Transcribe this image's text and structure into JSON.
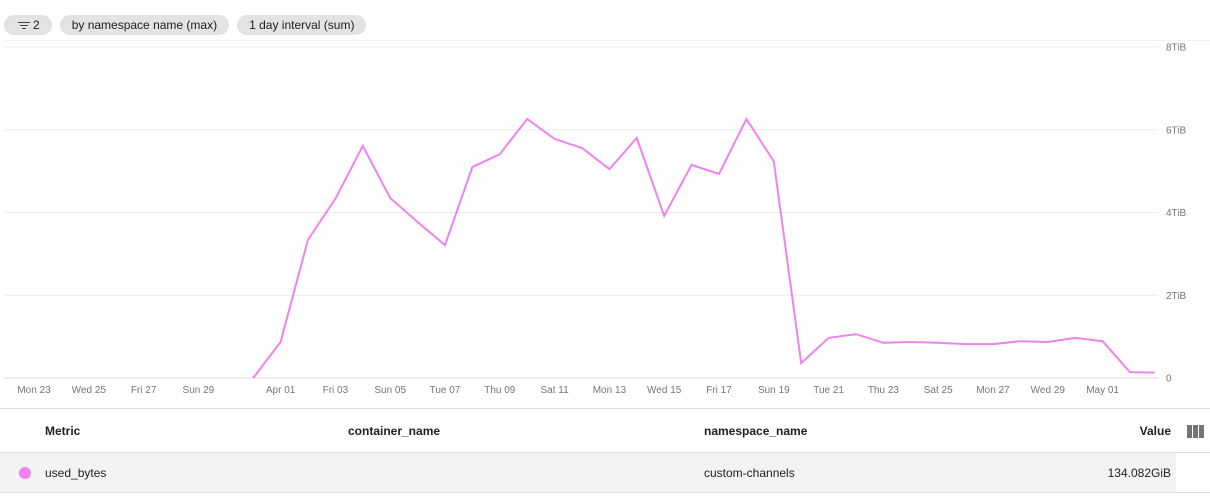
{
  "toolbar": {
    "filter_count": "2",
    "chips": [
      "by namespace name (max)",
      "1 day interval (sum)"
    ]
  },
  "chart_data": {
    "type": "line",
    "title": "",
    "xlabel": "",
    "ylabel": "",
    "y_unit": "TiB",
    "ylim": [
      0,
      8
    ],
    "yticks": [
      {
        "value": 0,
        "label": "0"
      },
      {
        "value": 2,
        "label": "2TiB"
      },
      {
        "value": 4,
        "label": "4TiB"
      },
      {
        "value": 6,
        "label": "6TiB"
      },
      {
        "value": 8,
        "label": "8TiB"
      }
    ],
    "x_range_days": [
      -1.5,
      40.6
    ],
    "xticks": [
      {
        "day": 0,
        "label": "Mon 23"
      },
      {
        "day": 2,
        "label": "Wed 25"
      },
      {
        "day": 4,
        "label": "Fri 27"
      },
      {
        "day": 6,
        "label": "Sun 29"
      },
      {
        "day": 9,
        "label": "Apr 01"
      },
      {
        "day": 11,
        "label": "Fri 03"
      },
      {
        "day": 13,
        "label": "Sun 05"
      },
      {
        "day": 15,
        "label": "Tue 07"
      },
      {
        "day": 17,
        "label": "Thu 09"
      },
      {
        "day": 19,
        "label": "Sat 11"
      },
      {
        "day": 21,
        "label": "Mon 13"
      },
      {
        "day": 23,
        "label": "Wed 15"
      },
      {
        "day": 25,
        "label": "Fri 17"
      },
      {
        "day": 27,
        "label": "Sun 19"
      },
      {
        "day": 29,
        "label": "Tue 21"
      },
      {
        "day": 31,
        "label": "Thu 23"
      },
      {
        "day": 33,
        "label": "Sat 25"
      },
      {
        "day": 35,
        "label": "Mon 27"
      },
      {
        "day": 37,
        "label": "Wed 29"
      },
      {
        "day": 39,
        "label": "May 01"
      }
    ],
    "grid": true,
    "legend": "table-below",
    "series": [
      {
        "name": "used_bytes",
        "color": "#ee82ee",
        "x_days": [
          8,
          9,
          10,
          11,
          12,
          13,
          14,
          15,
          16,
          17,
          18,
          19,
          20,
          21,
          22,
          23,
          24,
          25,
          26,
          27,
          28,
          29,
          30,
          31,
          32,
          33,
          34,
          35,
          36,
          37,
          38,
          39,
          40,
          40.9
        ],
        "values": [
          0,
          0.87,
          3.34,
          4.33,
          5.61,
          4.35,
          3.77,
          3.21,
          5.1,
          5.41,
          6.26,
          5.78,
          5.56,
          5.05,
          5.8,
          3.92,
          5.15,
          4.93,
          6.26,
          5.24,
          0.36,
          0.97,
          1.06,
          0.85,
          0.87,
          0.85,
          0.82,
          0.82,
          0.89,
          0.87,
          0.97,
          0.89,
          0.14,
          0.13
        ]
      }
    ]
  },
  "table": {
    "headers": {
      "metric": "Metric",
      "container_name": "container_name",
      "namespace_name": "namespace_name",
      "value": "Value"
    },
    "rows": [
      {
        "metric": "used_bytes",
        "color": "#ee82ee",
        "container_name": "",
        "namespace_name": "custom-channels",
        "value": "134.082GiB"
      }
    ],
    "column_picker_icon": "column-selector-icon"
  }
}
